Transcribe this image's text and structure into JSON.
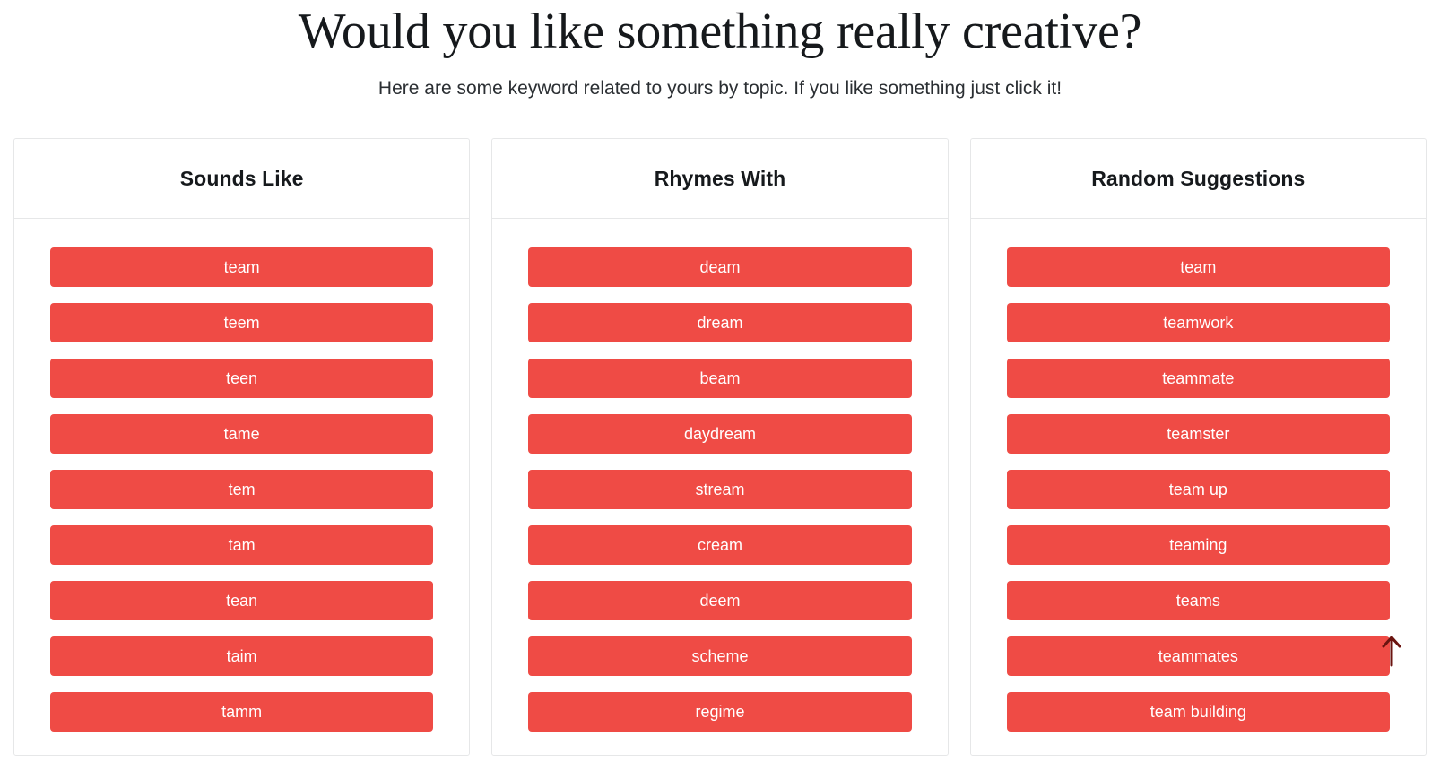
{
  "header": {
    "title": "Would you like something really creative?",
    "subtitle": "Here are some keyword related to yours by topic. If you like something just click it!"
  },
  "theme": {
    "button_color": "#ef4b45",
    "button_text_color": "#ffffff",
    "card_border_color": "#e6e7e8",
    "page_background": "#ffffff",
    "text_color": "#16191c",
    "arrow_color": "#6b1410"
  },
  "columns": [
    {
      "title": "Sounds Like",
      "words": [
        "team",
        "teem",
        "teen",
        "tame",
        "tem",
        "tam",
        "tean",
        "taim",
        "tamm"
      ]
    },
    {
      "title": "Rhymes With",
      "words": [
        "deam",
        "dream",
        "beam",
        "daydream",
        "stream",
        "cream",
        "deem",
        "scheme",
        "regime"
      ]
    },
    {
      "title": "Random Suggestions",
      "words": [
        "team",
        "teamwork",
        "teammate",
        "teamster",
        "team up",
        "teaming",
        "teams",
        "teammates",
        "team building"
      ]
    }
  ],
  "scroll_to_top": {
    "icon": "arrow-up-icon"
  }
}
